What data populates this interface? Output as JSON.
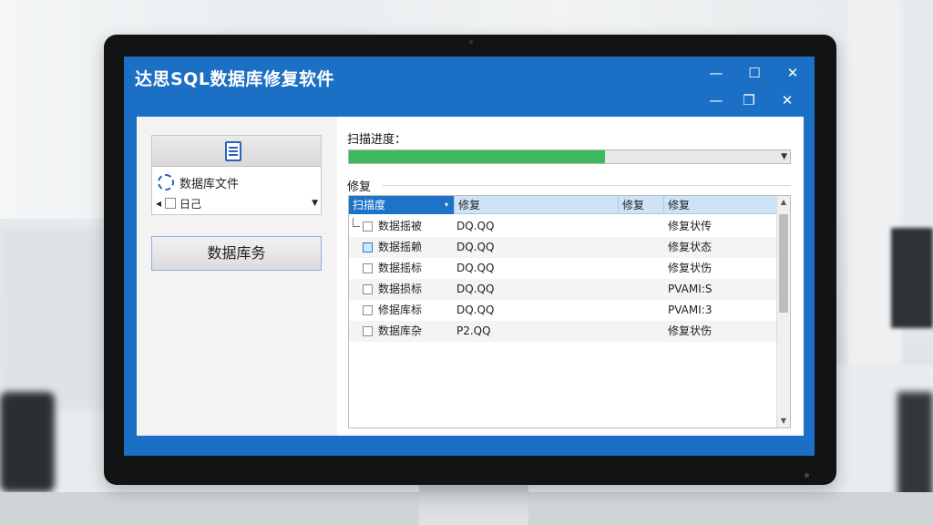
{
  "window": {
    "title": "达思SQL数据库修复软件",
    "controls": {
      "minimize": "—",
      "maximize": "☐",
      "close": "✕",
      "minimize2": "—",
      "restore": "❐",
      "close2": "✕"
    }
  },
  "left_panel": {
    "db_file_label": "数据库文件",
    "option_label": "日己",
    "action_button": "数据库务"
  },
  "progress": {
    "label": "扫描进度：",
    "value": 0.58
  },
  "repair": {
    "label": "修复",
    "columns": [
      "扫描度",
      "修复",
      "修复",
      "修复"
    ],
    "rows": [
      {
        "name": "数据摇被",
        "size": "DQ.QQ",
        "status": "修复状传",
        "checked": false,
        "tree": true
      },
      {
        "name": "数据摇赖",
        "size": "DQ.QQ",
        "status": "修复状态",
        "checked": true,
        "tree": false
      },
      {
        "name": "数据摇标",
        "size": "DQ.QQ",
        "status": "修复状伤",
        "checked": false,
        "tree": false
      },
      {
        "name": "数据损标",
        "size": "DQ.QQ",
        "status": "PVAMI:S",
        "checked": false,
        "tree": false
      },
      {
        "name": "修据库标",
        "size": "DQ.QQ",
        "status": "PVAMI:3",
        "checked": false,
        "tree": false
      },
      {
        "name": "数据库杂",
        "size": "P2.QQ",
        "status": "修复状伤",
        "checked": false,
        "tree": false
      }
    ]
  },
  "icons": {
    "document": "document-icon",
    "db_file": "refresh-database-icon",
    "dropdown": "chevron-down-icon"
  },
  "colors": {
    "title_bar": "#1b6fc4",
    "progress": "#3bba5b",
    "header_active": "#1d73c8"
  }
}
